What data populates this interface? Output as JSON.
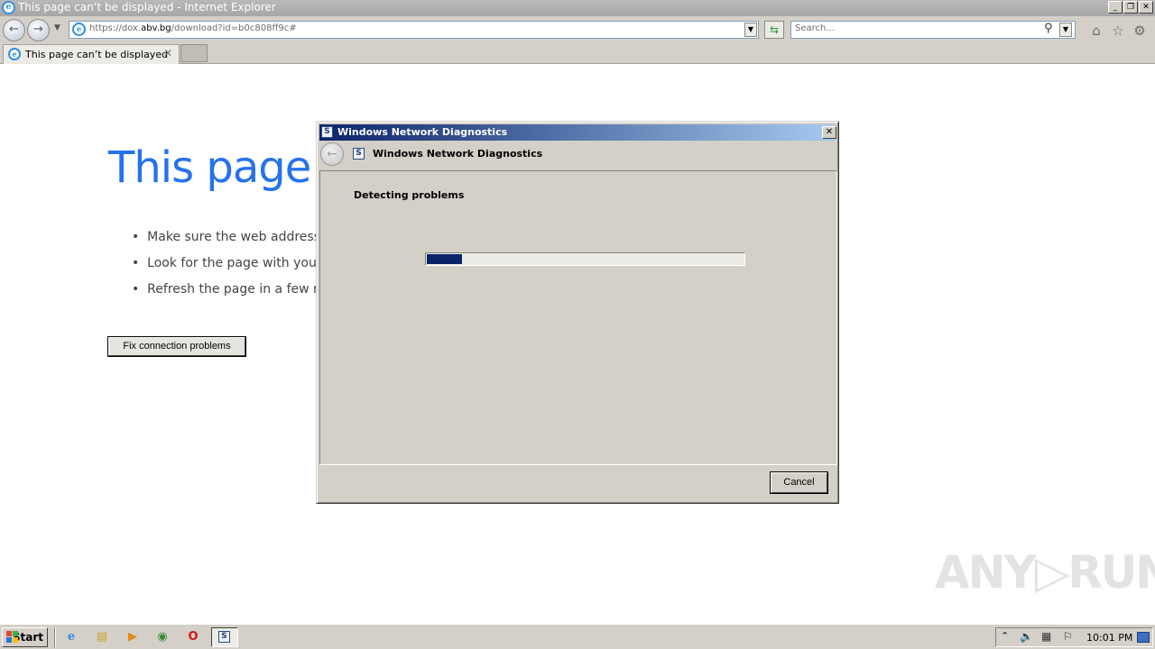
{
  "window": {
    "title": "This page can’t be displayed - Internet Explorer"
  },
  "address_bar": {
    "url_prefix": "https://dox.",
    "url_domain": "abv.bg",
    "url_suffix": "/download?id=b0c808ff9c#"
  },
  "search": {
    "placeholder": "Search..."
  },
  "tabs": [
    {
      "label": "This page can’t be displayed"
    }
  ],
  "page": {
    "heading": "This page c",
    "bullets": [
      "Make sure the web address h",
      "Look for the page with your",
      "Refresh the page in a few mi"
    ],
    "fix_button": "Fix connection problems"
  },
  "dialog": {
    "title": "Windows Network Diagnostics",
    "header": "Windows Network Diagnostics",
    "status": "Detecting problems",
    "progress_fraction": 0.11,
    "cancel_label": "Cancel"
  },
  "taskbar": {
    "start_label": "Start",
    "clock": "10:01 PM"
  },
  "watermark": {
    "text": "ANY▷RUN"
  },
  "colors": {
    "heading_blue": "#2672ec",
    "dialog_title_start": "#0a246a",
    "dialog_title_end": "#a6caf0",
    "progress_fill": "#0a246a"
  }
}
